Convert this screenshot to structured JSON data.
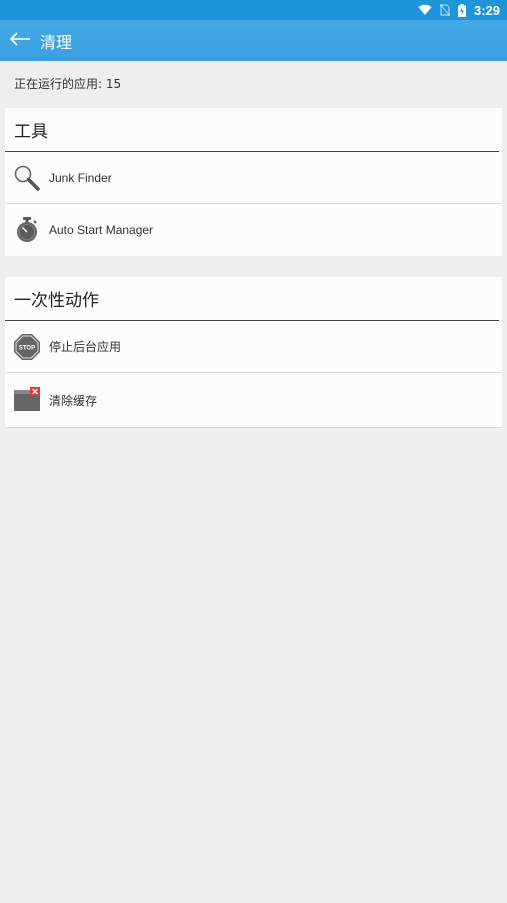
{
  "status_bar": {
    "time": "3:29",
    "icons": [
      "wifi-icon",
      "no-sim-icon",
      "battery-charging-icon"
    ]
  },
  "app_bar": {
    "back_icon": "back-arrow-icon",
    "title": "清理"
  },
  "running_apps": {
    "label": "正在运行的应用: 15"
  },
  "tools_section": {
    "header": "工具",
    "items": [
      {
        "icon": "magnifier-icon",
        "label": "Junk Finder"
      },
      {
        "icon": "stopwatch-icon",
        "label": "Auto Start Manager"
      }
    ]
  },
  "one_time_section": {
    "header": "一次性动作",
    "items": [
      {
        "icon": "stop-sign-icon",
        "label": "停止后台应用"
      },
      {
        "icon": "clear-cache-icon",
        "label": "清除缓存"
      }
    ]
  },
  "colors": {
    "status_bar": "#1f95d9",
    "app_bar": "#3fa5e3",
    "background": "#eeeeee",
    "card": "#fcfcfc"
  }
}
